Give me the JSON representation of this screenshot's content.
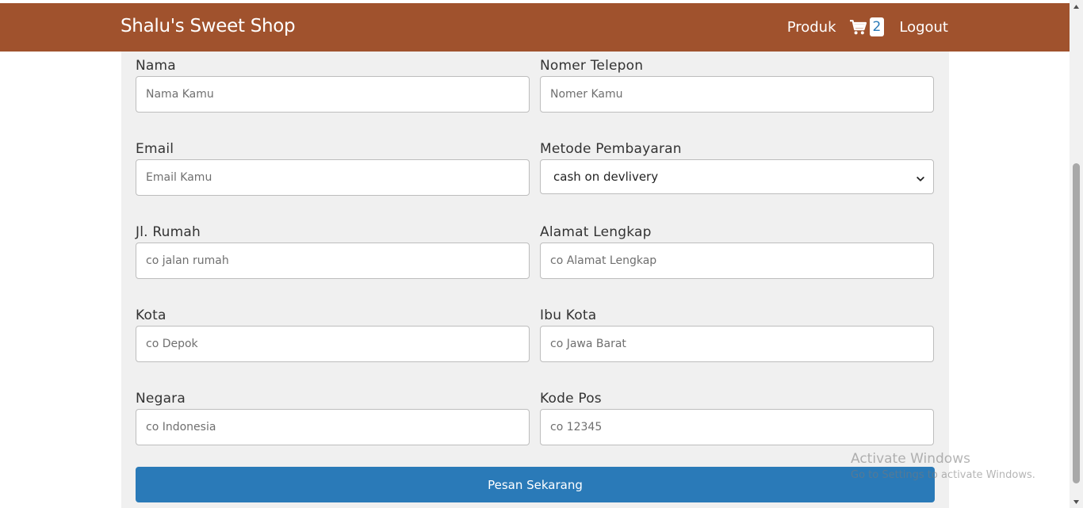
{
  "navbar": {
    "brand": "Shalu's Sweet Shop",
    "produk_label": "Produk",
    "cart_count": "2",
    "logout_label": "Logout"
  },
  "form": {
    "nama": {
      "label": "Nama",
      "placeholder": "Nama Kamu"
    },
    "telepon": {
      "label": "Nomer Telepon",
      "placeholder": "Nomer Kamu"
    },
    "email": {
      "label": "Email",
      "placeholder": "Email Kamu"
    },
    "metode": {
      "label": "Metode Pembayaran",
      "selected": "cash on devlivery"
    },
    "jalan": {
      "label": "Jl. Rumah",
      "placeholder": "co jalan rumah"
    },
    "alamat": {
      "label": "Alamat Lengkap",
      "placeholder": "co Alamat Lengkap"
    },
    "kota": {
      "label": "Kota",
      "placeholder": "co Depok"
    },
    "ibukota": {
      "label": "Ibu Kota",
      "placeholder": "co Jawa Barat"
    },
    "negara": {
      "label": "Negara",
      "placeholder": "co Indonesia"
    },
    "kodepos": {
      "label": "Kode Pos",
      "placeholder": "co 12345"
    },
    "submit_label": "Pesan Sekarang"
  },
  "watermark": {
    "title": "Activate Windows",
    "subtitle": "Go to Settings to activate Windows."
  },
  "colors": {
    "navbar": "#a0522d",
    "button": "#2a7ab8",
    "panel": "#f0f0f0"
  },
  "icons": {
    "cart": "shopping-cart-icon",
    "select": "chevron-down-icon"
  }
}
